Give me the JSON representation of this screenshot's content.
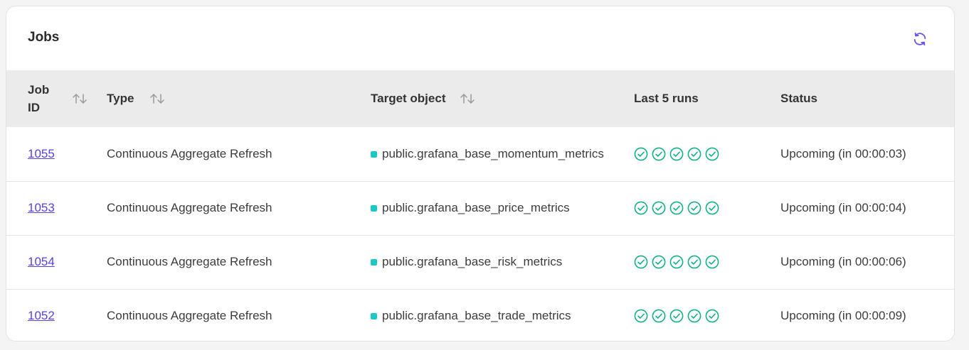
{
  "header": {
    "title": "Jobs",
    "refresh_icon": "refresh-icon"
  },
  "table": {
    "columns": [
      {
        "label": "Job ID",
        "sortable": true
      },
      {
        "label": "Type",
        "sortable": true
      },
      {
        "label": "Target object",
        "sortable": true
      },
      {
        "label": "Last 5 runs",
        "sortable": false
      },
      {
        "label": "Status",
        "sortable": false
      }
    ],
    "rows": [
      {
        "job_id": "1055",
        "type": "Continuous Aggregate Refresh",
        "target": "public.grafana_base_momentum_metrics",
        "last_runs": [
          "success",
          "success",
          "success",
          "success",
          "success"
        ],
        "status": "Upcoming (in 00:00:03)"
      },
      {
        "job_id": "1053",
        "type": "Continuous Aggregate Refresh",
        "target": "public.grafana_base_price_metrics",
        "last_runs": [
          "success",
          "success",
          "success",
          "success",
          "success"
        ],
        "status": "Upcoming (in 00:00:04)"
      },
      {
        "job_id": "1054",
        "type": "Continuous Aggregate Refresh",
        "target": "public.grafana_base_risk_metrics",
        "last_runs": [
          "success",
          "success",
          "success",
          "success",
          "success"
        ],
        "status": "Upcoming (in 00:00:06)"
      },
      {
        "job_id": "1052",
        "type": "Continuous Aggregate Refresh",
        "target": "public.grafana_base_trade_metrics",
        "last_runs": [
          "success",
          "success",
          "success",
          "success",
          "success"
        ],
        "status": "Upcoming (in 00:00:09)"
      }
    ]
  },
  "colors": {
    "link": "#5b3ee0",
    "accent": "#6b4ff0",
    "success": "#12b08a",
    "target_dot": "#1cc7c9",
    "header_bg": "#ebebeb"
  }
}
